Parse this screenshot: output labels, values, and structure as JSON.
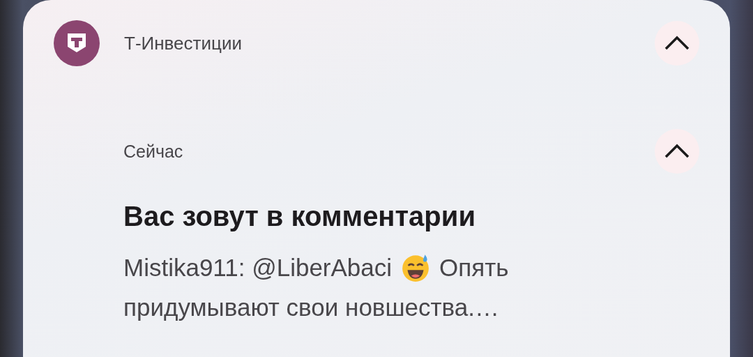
{
  "notification": {
    "app_name": "Т-Инвестиции",
    "expanded": true,
    "time": "Сейчас",
    "item_expanded": true,
    "title": "Вас зовут в комментарии",
    "message_lines": [
      [
        {
          "kind": "text",
          "text": "Mistika911: @LiberAbaci"
        },
        {
          "kind": "emoji"
        },
        {
          "kind": "text",
          "text": "Опять"
        }
      ],
      [
        {
          "kind": "text",
          "text": "придумывают свои новшества.…"
        }
      ]
    ]
  }
}
